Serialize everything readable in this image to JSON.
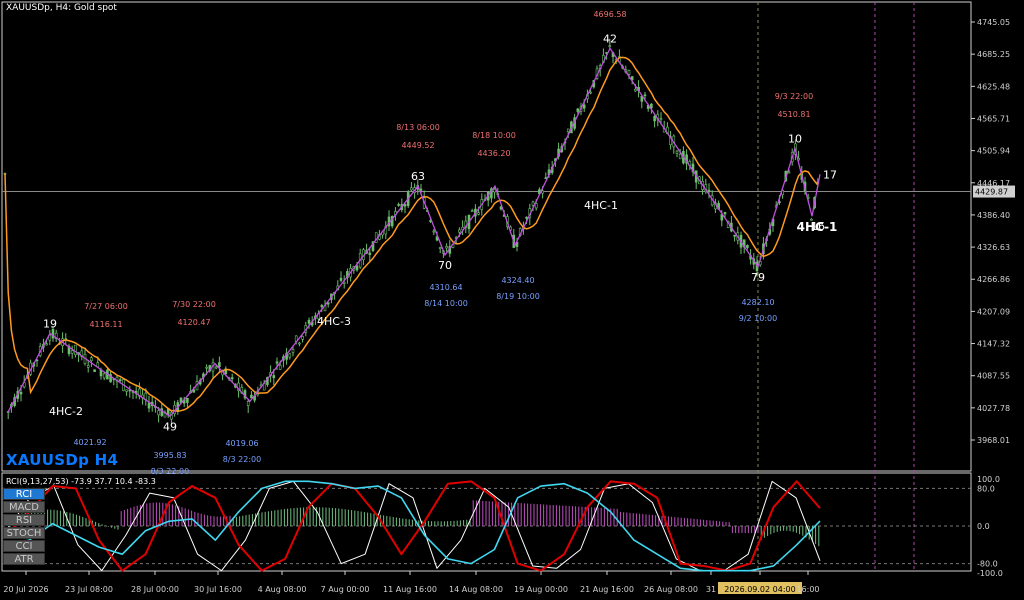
{
  "header": {
    "title": "XAUUSDp, H4:  Gold spot",
    "watermark": "XAUUSDp H4",
    "indicator_label": "RCI(9,13,27,53) -73.9 37.7 10.4 -83.3"
  },
  "indicator_buttons": [
    {
      "label": "RCI",
      "active": true
    },
    {
      "label": "MACD",
      "active": false
    },
    {
      "label": "RSI",
      "active": false
    },
    {
      "label": "STOCH",
      "active": false
    },
    {
      "label": "CCI",
      "active": false
    },
    {
      "label": "ATR",
      "active": false
    }
  ],
  "colors": {
    "background": "#000000",
    "frame": "#cfcfcf",
    "zigzag": "#c050e0",
    "ma": "#ff9a20",
    "candle": "#6cc06c",
    "high_note": "#f07070",
    "low_note": "#78a0ff",
    "grid_dash": "#777777",
    "crosshair": "#b048b0",
    "price_tag_bg": "#d0d0d0",
    "rci_white": "#ffffff",
    "rci_red": "#e00000",
    "rci_cyan": "#40d8f0",
    "hist_pos": "#70c080",
    "hist_neg": "#c050c0",
    "time_highlight": "#e0c060"
  },
  "chart_data": [
    {
      "type": "candlestick",
      "title": "XAUUSDp, H4:  Gold spot",
      "ylim": [
        3940,
        4780
      ],
      "y_ticks": [
        "4745.05",
        "4685.25",
        "4625.48",
        "4565.71",
        "4505.94",
        "4446.17",
        "4386.40",
        "4326.63",
        "4266.86",
        "4207.09",
        "4147.32",
        "4087.55",
        "4027.78",
        "3968.01"
      ],
      "current_price": "4429.87",
      "x_ticks": [
        "20 Jul 2026",
        "23 Jul 08:00",
        "28 Jul 00:00",
        "30 Jul 16:00",
        "4 Aug 08:00",
        "7 Aug 00:00",
        "11 Aug 16:00",
        "14 Aug 08:00",
        "19 Aug 00:00",
        "21 Aug 16:00",
        "26 Aug 08:00",
        "31",
        "2026.09.02 04:00",
        "16:00"
      ],
      "zigzag": [
        {
          "time": "20 Jul",
          "price": 4020
        },
        {
          "time": "7/21",
          "price": 4166,
          "label": "19"
        },
        {
          "time": "7/27 06:00",
          "price": 4100
        },
        {
          "time": "7/28",
          "price": 4012,
          "label": "49"
        },
        {
          "time": "7/30 22:00",
          "price": 4110
        },
        {
          "time": "8/3 22:00",
          "price": 4040
        },
        {
          "time": "8/13 06:00",
          "price": 4440,
          "label": "63"
        },
        {
          "time": "8/14 10:00",
          "price": 4312,
          "label": "70"
        },
        {
          "time": "8/18 10:00",
          "price": 4435
        },
        {
          "time": "8/19 10:00",
          "price": 4420
        },
        {
          "time": "8/21",
          "price": 4696.58,
          "label": "42"
        },
        {
          "time": "9/2 10:00",
          "price": 4290,
          "label": "79"
        },
        {
          "time": "9/3 22:00",
          "price": 4510.81,
          "label": "10"
        },
        {
          "time": "9/4",
          "price": 4384,
          "label": "16"
        },
        {
          "time": "9/4 04:00",
          "price": 4462,
          "label": "17"
        }
      ],
      "high_annotations": [
        {
          "time": "7/27 06:00",
          "price": "4116.11"
        },
        {
          "time": "7/30 22:00",
          "price": "4120.47"
        },
        {
          "time": "8/13 06:00",
          "price": "4449.52"
        },
        {
          "time": "8/18 10:00",
          "price": "4436.20"
        },
        {
          "time": "",
          "price": "4696.58"
        },
        {
          "time": "9/3 22:00",
          "price": "4510.81"
        }
      ],
      "low_annotations": [
        {
          "time": "",
          "price": "4021.92"
        },
        {
          "time": "8/3 22:00",
          "price": "3995.83"
        },
        {
          "time": "8/3 22:00",
          "price": "4019.06"
        },
        {
          "time": "8/14 10:00",
          "price": "4310.64"
        },
        {
          "time": "8/19 10:00",
          "price": "4324.40"
        },
        {
          "time": "9/2 10:00",
          "price": "4282.10"
        }
      ],
      "wave_labels": [
        "4HC-2",
        "4HC-3",
        "4HC-1",
        "4HC-1"
      ]
    },
    {
      "type": "line",
      "title": "RCI(9,13,27,53) -73.9 37.7 10.4 -83.3",
      "ylim": [
        -100,
        100
      ],
      "y_ticks": [
        "100.0",
        "80.0",
        "0.0",
        "-80.0",
        "-100.0"
      ],
      "series": [
        {
          "name": "RCI 9",
          "values": [
            -10,
            60,
            85,
            -40,
            -95,
            -20,
            70,
            60,
            -60,
            -95,
            -30,
            80,
            95,
            30,
            -80,
            -60,
            90,
            60,
            -90,
            -30,
            80,
            40,
            -85,
            -90,
            -50,
            80,
            90,
            50,
            -70,
            -95,
            -95,
            -60,
            95,
            60,
            -73.9
          ]
        },
        {
          "name": "RCI 13",
          "values": [
            -20,
            30,
            85,
            80,
            -30,
            -95,
            -60,
            50,
            85,
            60,
            -40,
            -95,
            -70,
            40,
            90,
            80,
            20,
            -60,
            10,
            90,
            95,
            60,
            -80,
            -95,
            -60,
            40,
            95,
            90,
            60,
            -80,
            -85,
            -95,
            -80,
            40,
            95,
            37.7
          ]
        },
        {
          "name": "RCI 27",
          "values": [
            -40,
            -30,
            5,
            -20,
            -45,
            -60,
            -10,
            10,
            15,
            -30,
            30,
            80,
            95,
            95,
            90,
            80,
            85,
            60,
            -20,
            -70,
            -80,
            -50,
            60,
            85,
            90,
            70,
            30,
            -30,
            -60,
            -90,
            -95,
            -95,
            -95,
            -85,
            -40,
            10.4
          ]
        }
      ],
      "histogram_pattern": "positive green Jul 30–Aug 23, negative magenta Aug 24–31, negative green Sep 1–4"
    }
  ]
}
